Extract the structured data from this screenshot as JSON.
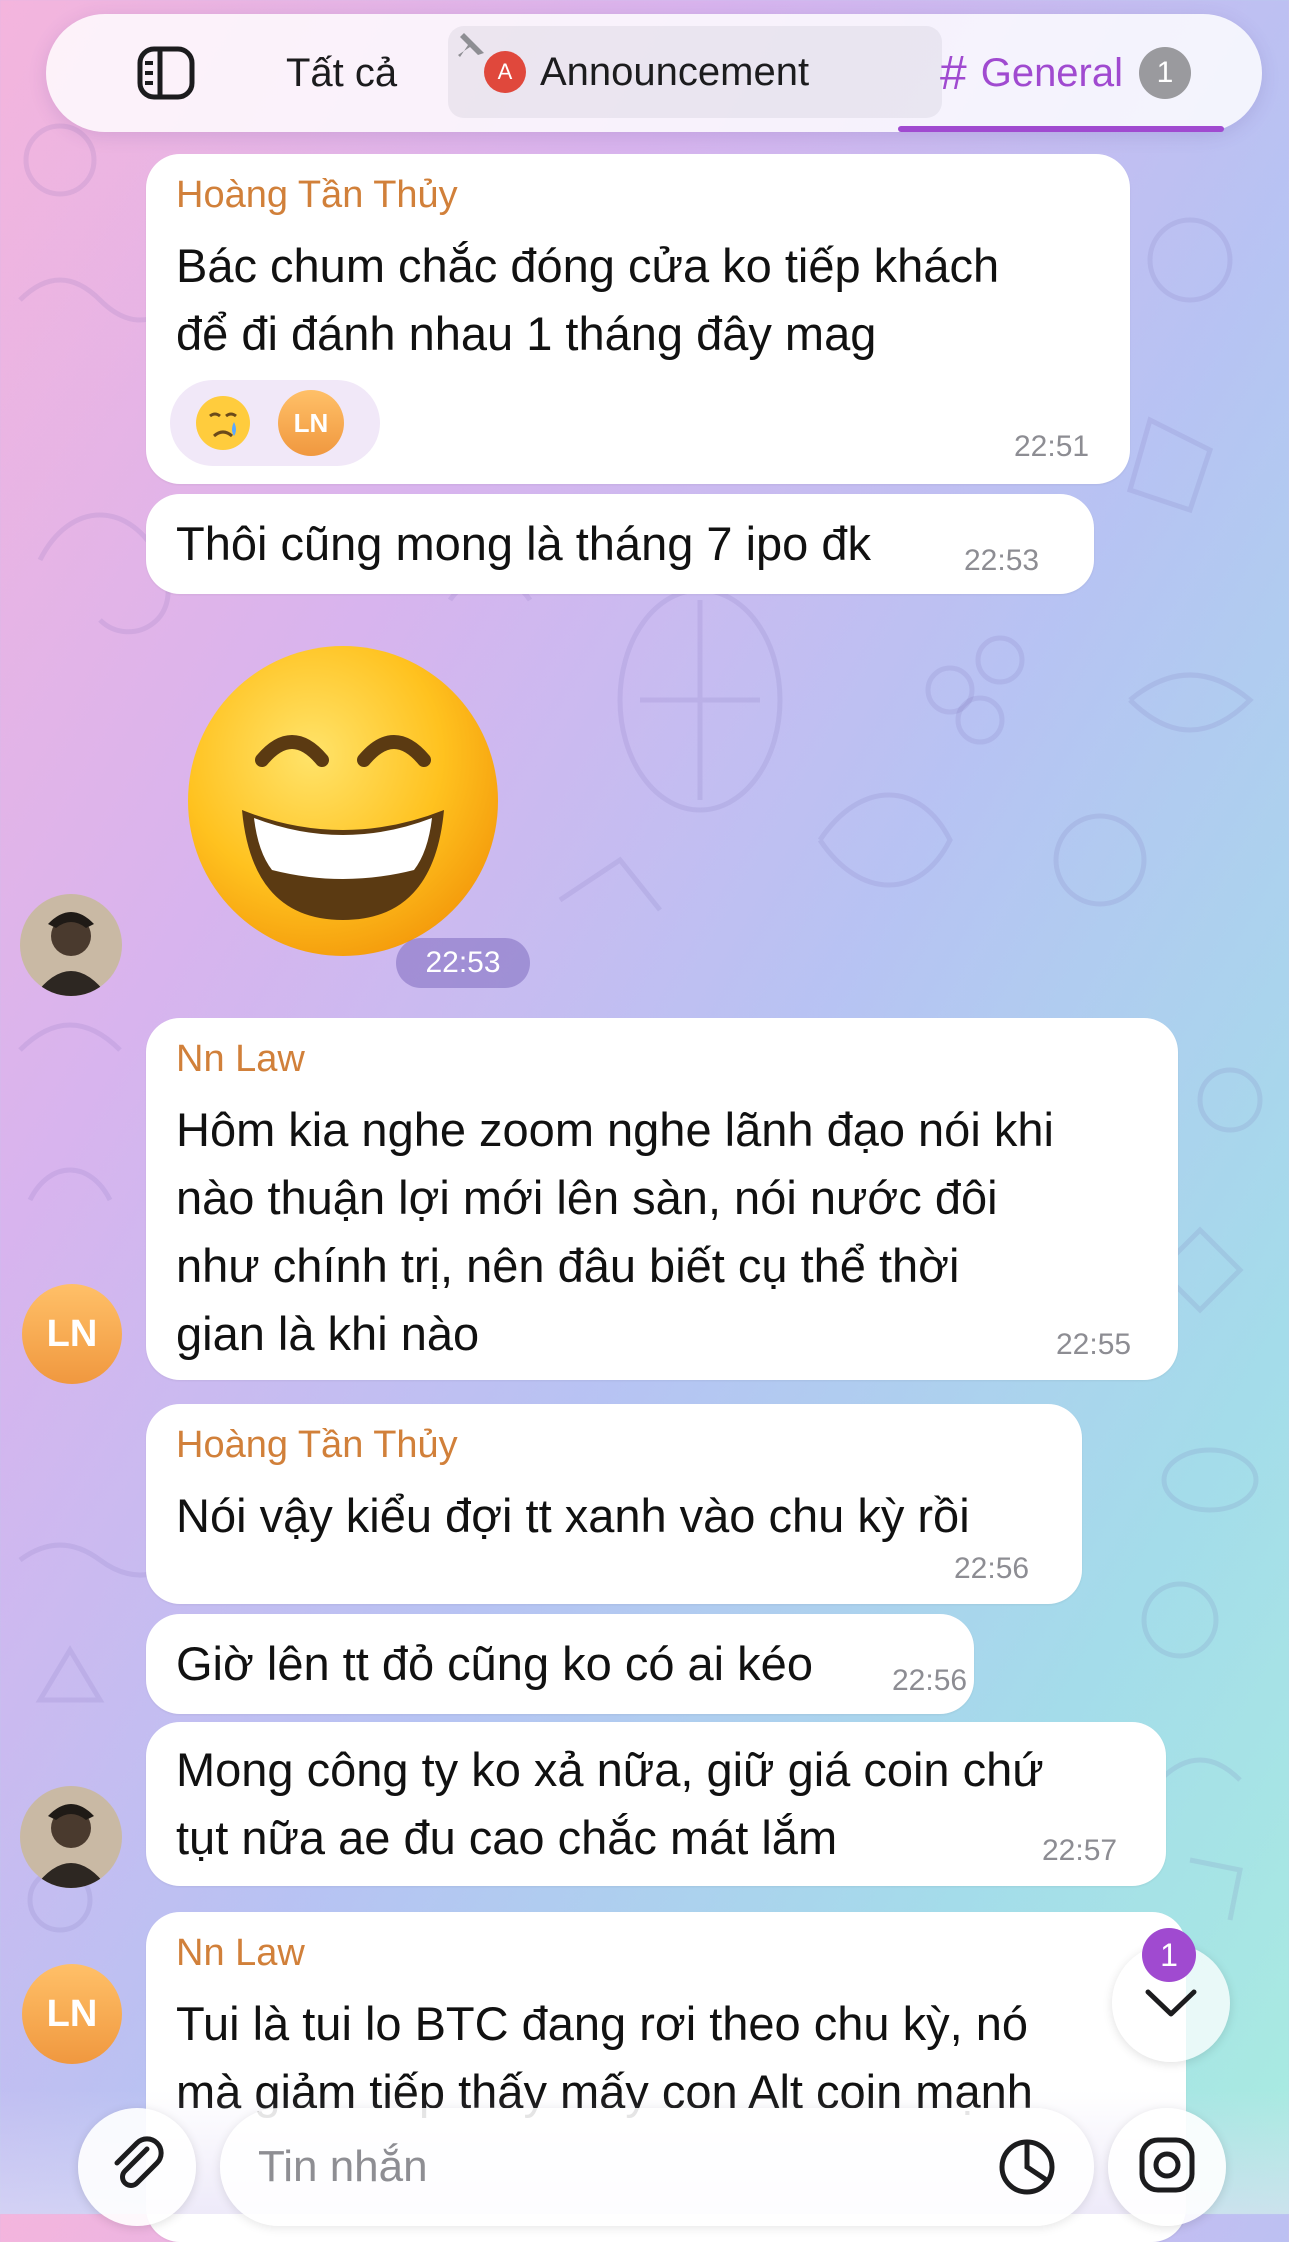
{
  "tabs": [
    {
      "label": "Tất cả"
    },
    {
      "label": "Announcement",
      "badge": "A"
    },
    {
      "label": "General",
      "count": "1"
    }
  ],
  "messages": [
    {
      "sender": "Hoàng Tần Thủy",
      "text": "Bác chum chắc đóng cửa ko tiếp khách\nđể đi đánh nhau 1 tháng đây mag",
      "time": "22:51",
      "reaction_avatar": "LN"
    },
    {
      "text": "Thôi cũng mong là tháng 7 ipo đk",
      "time": "22:53"
    },
    {
      "sticker": "grinning-face",
      "time": "22:53"
    },
    {
      "sender": "Nn Law",
      "text": "Hôm kia nghe zoom nghe lãnh đạo nói khi\nnào thuận lợi mới lên sàn, nói nước đôi\nnhư chính trị, nên đâu biết cụ thể thời\ngian là khi nào",
      "time": "22:55",
      "avatar": "LN"
    },
    {
      "sender": "Hoàng Tần Thủy",
      "text": "Nói vậy kiểu đợi tt xanh vào chu kỳ rồi",
      "time": "22:56"
    },
    {
      "text": "Giờ lên tt đỏ cũng ko có ai kéo",
      "time": "22:56"
    },
    {
      "text": "Mong công ty ko xả nữa, giữ giá coin chứ\ntụt nữa ae đu cao chắc mát lắm",
      "time": "22:57"
    },
    {
      "sender": "Nn Law",
      "text": "Tui là tui lo BTC đang rơi theo chu kỳ, nó\nmà giảm tiếp thấy mấy con Alt coin mạnh",
      "avatar": "LN"
    }
  ],
  "scroll_badge": "1",
  "composer": {
    "placeholder": "Tin nhắn"
  },
  "colors": {
    "accent": "#a04ad0",
    "sender_name": "#d1803a",
    "avatar_ln": "#f5a64a"
  }
}
